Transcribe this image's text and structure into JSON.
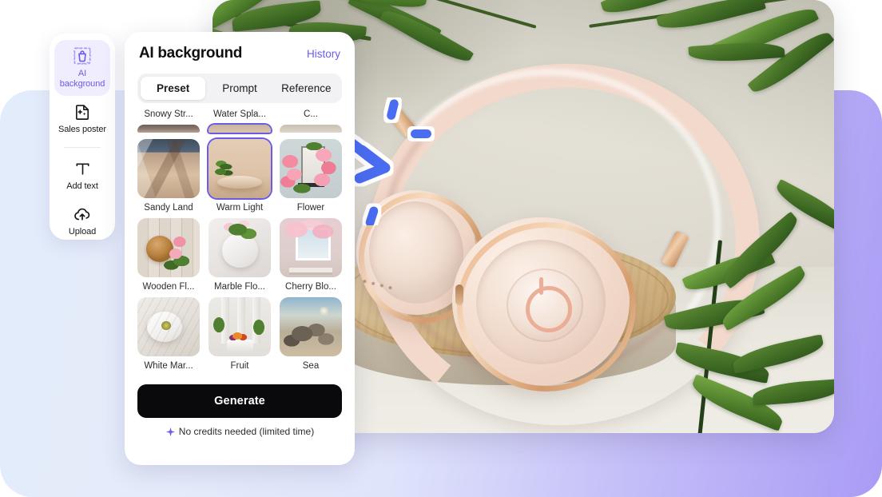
{
  "theme": {
    "accent": "#6b5ce7",
    "annotation_blue": "#4a6cf0",
    "panel_bg": "#ffffff",
    "generate_bg": "#0a0a0c",
    "backdrop_left": "#e3ecfb",
    "backdrop_right": "#a99bf5"
  },
  "rail": {
    "items": [
      {
        "id": "ai-background",
        "label": "AI\nbackground",
        "label_line1": "AI",
        "label_line2": "background",
        "icon": "bag-crop-icon",
        "active": true
      },
      {
        "id": "sales-poster",
        "label": "Sales poster",
        "icon": "poster-sparkle-icon",
        "active": false
      },
      {
        "id": "add-text",
        "label": "Add text",
        "icon": "text-t-icon",
        "active": false
      },
      {
        "id": "upload",
        "label": "Upload",
        "icon": "cloud-upload-icon",
        "active": false
      }
    ]
  },
  "panel": {
    "title": "AI background",
    "history_label": "History",
    "tabs": [
      {
        "id": "preset",
        "label": "Preset",
        "active": true
      },
      {
        "id": "prompt",
        "label": "Prompt",
        "active": false
      },
      {
        "id": "reference",
        "label": "Reference",
        "active": false
      }
    ],
    "clipped_row": [
      {
        "label": "Snowy Str...",
        "art": "t-snowy"
      },
      {
        "label": "Water Spla...",
        "art": "t-water"
      },
      {
        "label": "C...",
        "art": "t-cut"
      }
    ],
    "presets": [
      {
        "label": "Sandy Land",
        "art": "t-sand",
        "selected": false
      },
      {
        "label": "Warm Light",
        "art": "t-warm",
        "selected": true
      },
      {
        "label": "Flower",
        "art": "t-flower",
        "selected": false
      },
      {
        "label": "Wooden Fl...",
        "art": "t-wood",
        "selected": false
      },
      {
        "label": "Marble Flo...",
        "art": "t-marble",
        "selected": false
      },
      {
        "label": "Cherry Blo...",
        "art": "t-cherry",
        "selected": false
      },
      {
        "label": "White Mar...",
        "art": "t-white",
        "selected": false
      },
      {
        "label": "Fruit",
        "art": "t-fruit",
        "selected": false
      },
      {
        "label": "Sea",
        "art": "t-sea",
        "selected": false
      }
    ],
    "generate_label": "Generate",
    "credits_note": "No credits needed (limited time)",
    "credits_icon": "sparkle-icon"
  },
  "canvas": {
    "alt": "Rose-gold over-ear headphones on a round wooden podium with green palm leaves",
    "annotation": {
      "icon": "curved-arrow-annotation",
      "color": "#4a6cf0"
    }
  }
}
